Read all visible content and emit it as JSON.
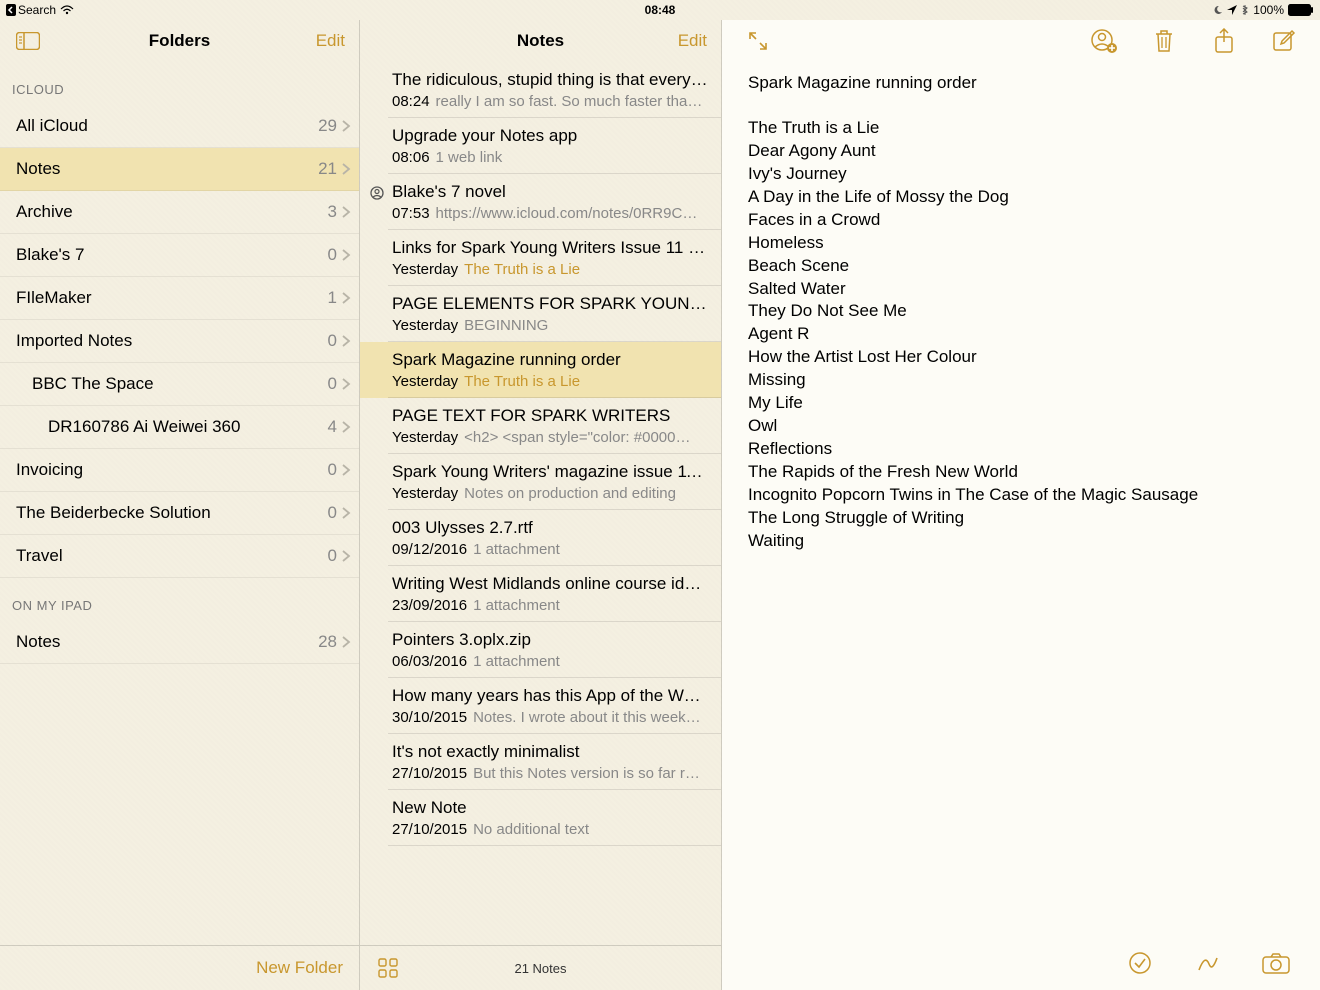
{
  "statusbar": {
    "back_label": "Search",
    "time": "08:48",
    "battery_text": "100%"
  },
  "folders_pane": {
    "title": "Folders",
    "edit_label": "Edit",
    "new_folder_label": "New Folder",
    "sections": [
      {
        "label": "ICLOUD",
        "items": [
          {
            "name": "All iCloud",
            "count": 29,
            "indent": 0,
            "selected": false
          },
          {
            "name": "Notes",
            "count": 21,
            "indent": 0,
            "selected": true
          },
          {
            "name": "Archive",
            "count": 3,
            "indent": 0,
            "selected": false
          },
          {
            "name": "Blake's 7",
            "count": 0,
            "indent": 0,
            "selected": false
          },
          {
            "name": "FIleMaker",
            "count": 1,
            "indent": 0,
            "selected": false
          },
          {
            "name": "Imported Notes",
            "count": 0,
            "indent": 0,
            "selected": false
          },
          {
            "name": "BBC The Space",
            "count": 0,
            "indent": 1,
            "selected": false
          },
          {
            "name": "DR160786 Ai Weiwei 360",
            "count": 4,
            "indent": 2,
            "selected": false
          },
          {
            "name": "Invoicing",
            "count": 0,
            "indent": 0,
            "selected": false
          },
          {
            "name": "The Beiderbecke Solution",
            "count": 0,
            "indent": 0,
            "selected": false
          },
          {
            "name": "Travel",
            "count": 0,
            "indent": 0,
            "selected": false
          }
        ]
      },
      {
        "label": "ON MY IPAD",
        "items": [
          {
            "name": "Notes",
            "count": 28,
            "indent": 0,
            "selected": false
          }
        ]
      }
    ]
  },
  "notes_pane": {
    "title": "Notes",
    "edit_label": "Edit",
    "footer_count": "21 Notes",
    "items": [
      {
        "title": "The ridiculous, stupid thing is that every…",
        "time": "08:24",
        "preview": "really I am so fast. So much faster tha…",
        "shared": false,
        "selected": false,
        "link": false
      },
      {
        "title": "Upgrade your Notes app",
        "time": "08:06",
        "preview": "1 web link",
        "shared": false,
        "selected": false,
        "link": false
      },
      {
        "title": "Blake's 7 novel",
        "time": "07:53",
        "preview": "https://www.icloud.com/notes/0RR9C…",
        "shared": true,
        "selected": false,
        "link": false
      },
      {
        "title": "Links for Spark Young Writers Issue 11 p…",
        "time": "Yesterday",
        "preview": "The Truth is a Lie",
        "shared": false,
        "selected": false,
        "link": true
      },
      {
        "title": "PAGE ELEMENTS FOR SPARK YOUNG…",
        "time": "Yesterday",
        "preview": "BEGINNING",
        "shared": false,
        "selected": false,
        "link": false
      },
      {
        "title": "Spark Magazine running order",
        "time": "Yesterday",
        "preview": "The Truth is a Lie",
        "shared": false,
        "selected": true,
        "link": true
      },
      {
        "title": "PAGE TEXT FOR SPARK WRITERS",
        "time": "Yesterday",
        "preview": "<h2> <span style=\"color: #0000…",
        "shared": false,
        "selected": false,
        "link": false
      },
      {
        "title": "Spark Young Writers' magazine issue 11…",
        "time": "Yesterday",
        "preview": "Notes on production and editing",
        "shared": false,
        "selected": false,
        "link": false
      },
      {
        "title": "003 Ulysses 2.7.rtf",
        "time": "09/12/2016",
        "preview": "1 attachment",
        "shared": false,
        "selected": false,
        "link": false
      },
      {
        "title": "Writing West Midlands online course ide…",
        "time": "23/09/2016",
        "preview": "1 attachment",
        "shared": false,
        "selected": false,
        "link": false
      },
      {
        "title": "Pointers 3.oplx.zip",
        "time": "06/03/2016",
        "preview": "1 attachment",
        "shared": false,
        "selected": false,
        "link": false
      },
      {
        "title": "How many years has this App of the We…",
        "time": "30/10/2015",
        "preview": "Notes. I wrote about it this week…",
        "shared": false,
        "selected": false,
        "link": false
      },
      {
        "title": "It's not exactly minimalist",
        "time": "27/10/2015",
        "preview": "But this Notes version is so far r…",
        "shared": false,
        "selected": false,
        "link": false
      },
      {
        "title": "New Note",
        "time": "27/10/2015",
        "preview": "No additional text",
        "shared": false,
        "selected": false,
        "link": false
      }
    ]
  },
  "editor": {
    "title": "Spark Magazine running order",
    "lines": [
      "The Truth is a Lie",
      "Dear Agony Aunt",
      "Ivy's Journey",
      "A Day in the Life of Mossy the Dog",
      "Faces in a Crowd",
      "Homeless",
      "Beach Scene",
      "Salted Water",
      "They Do Not See Me",
      "Agent R",
      "How the Artist Lost Her Colour",
      "Missing",
      "My Life",
      "Owl",
      "Reflections",
      "The Rapids of the Fresh New World",
      "Incognito Popcorn Twins in The Case of the Magic Sausage",
      "The Long Struggle of Writing",
      "Waiting"
    ]
  }
}
